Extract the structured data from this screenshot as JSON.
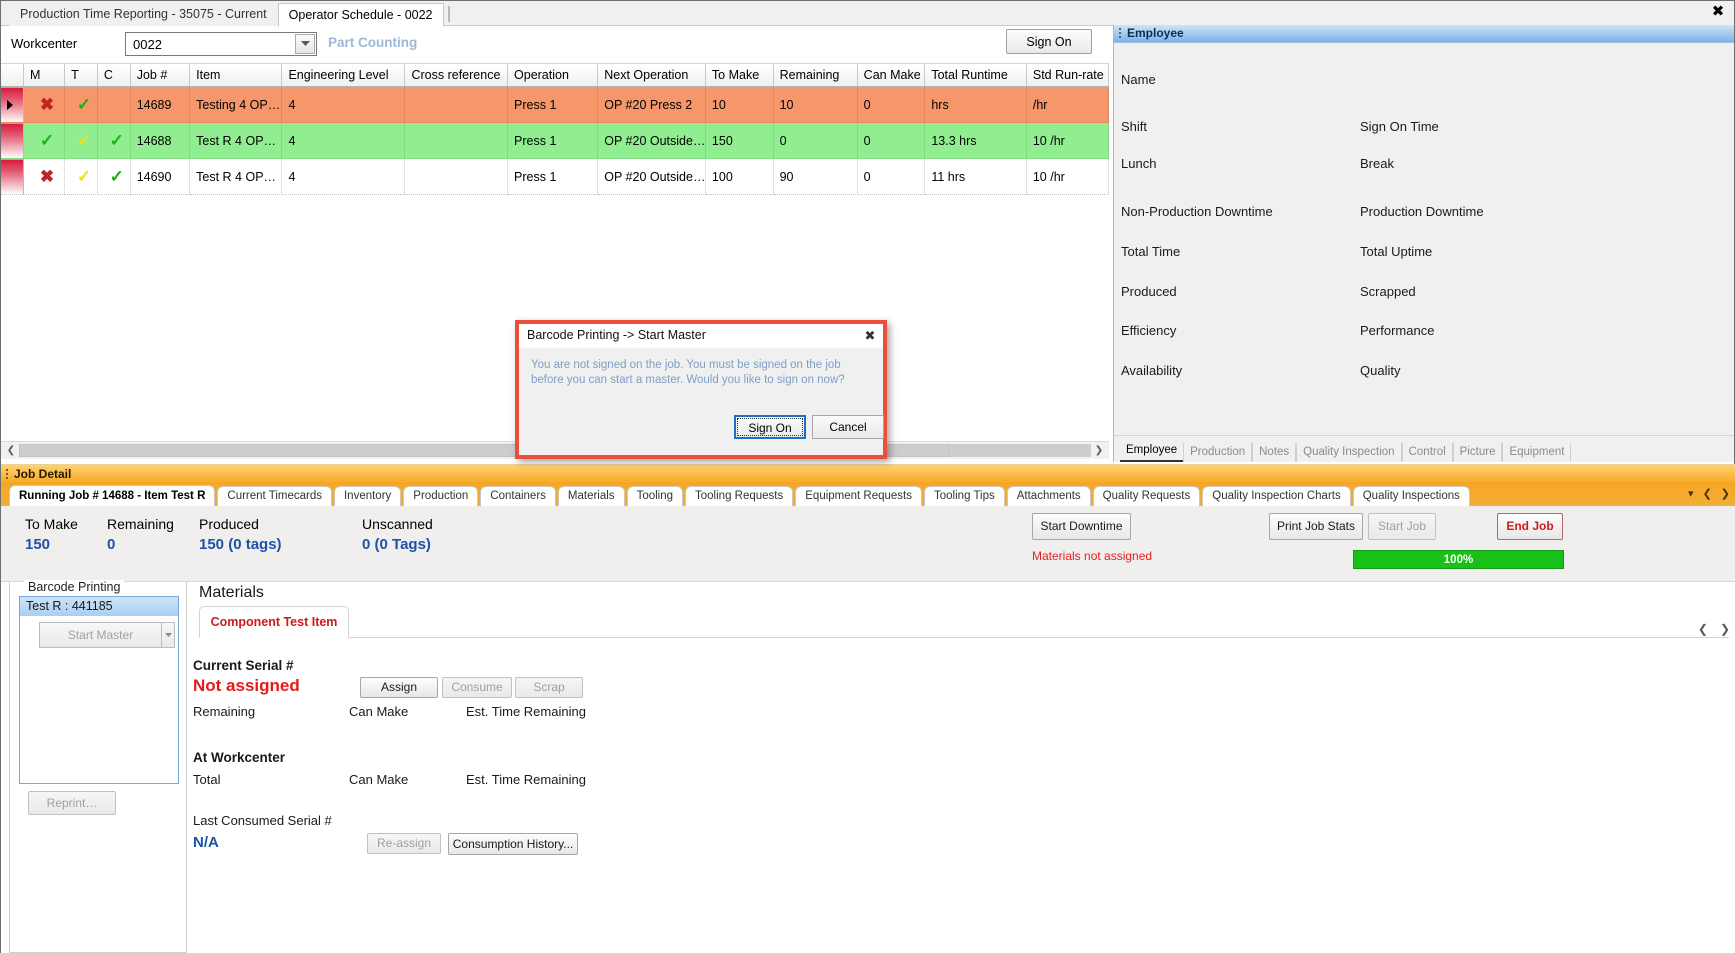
{
  "window": {
    "close_icon": "close-icon"
  },
  "top_tabs": [
    {
      "label": "Production Time Reporting - 35075 - Current",
      "selected": false
    },
    {
      "label": "Operator Schedule - 0022",
      "selected": true
    }
  ],
  "workcenter": {
    "label": "Workcenter",
    "value": "0022",
    "placeholder": "Workcenter",
    "status_text": "Part Counting",
    "sign_on_button": "Sign On"
  },
  "grid": {
    "columns": [
      "M",
      "T",
      "C",
      "Job #",
      "Item",
      "Engineering Level",
      "Cross reference",
      "Operation",
      "Next Operation",
      "To Make",
      "Remaining",
      "Can Make",
      "Total Runtime",
      "Std Run-rate"
    ],
    "rows": [
      {
        "selected": true,
        "row_color": "#f5976b",
        "m": "x",
        "t": "check-green",
        "c": "",
        "job": "14689",
        "item": "Testing  4  OP…",
        "eng_level": "4",
        "cross_ref": "",
        "operation": "Press 1",
        "next_operation": "OP #20 Press 2",
        "to_make": "10",
        "remaining": "10",
        "can_make": "0",
        "total_runtime": "hrs",
        "std_run_rate": "/hr"
      },
      {
        "selected": false,
        "row_color": "#90ee90",
        "m": "check-green",
        "t": "check-yellow",
        "c": "check-green",
        "job": "14688",
        "item": "Test R 4 OP…",
        "eng_level": "4",
        "cross_ref": "",
        "operation": "Press 1",
        "next_operation": "OP  #20  Outside…",
        "to_make": "150",
        "remaining": "0",
        "can_make": "0",
        "total_runtime": "13.3 hrs",
        "std_run_rate": "10 /hr"
      },
      {
        "selected": false,
        "row_color": "#ffffff",
        "m": "x",
        "t": "check-yellow",
        "c": "check-green",
        "job": "14690",
        "item": "Test R 4 OP…",
        "eng_level": "4",
        "cross_ref": "",
        "operation": "Press 1",
        "next_operation": "OP  #20  Outside…",
        "to_make": "100",
        "remaining": "90",
        "can_make": "0",
        "total_runtime": "11 hrs",
        "std_run_rate": "10 /hr"
      }
    ]
  },
  "employee_panel": {
    "title": "Employee",
    "labels_left": [
      "Name",
      "Shift",
      "Lunch",
      "Non-Production Downtime",
      "Total Time",
      "Produced",
      "Efficiency",
      "Availability"
    ],
    "labels_right": [
      "Sign On Time",
      "Break",
      "Production Downtime",
      "Total Uptime",
      "Scrapped",
      "Performance",
      "Quality"
    ],
    "tabs": [
      {
        "label": "Employee",
        "selected": true
      },
      {
        "label": "Production",
        "selected": false
      },
      {
        "label": "Notes",
        "selected": false
      },
      {
        "label": "Quality Inspection",
        "selected": false
      },
      {
        "label": "Control",
        "selected": false
      },
      {
        "label": "Picture",
        "selected": false
      },
      {
        "label": "Equipment",
        "selected": false
      }
    ]
  },
  "job_detail": {
    "bar_title": "Job Detail",
    "tabs": [
      {
        "label": "Running Job # 14688 - Item Test R",
        "selected": true
      },
      {
        "label": "Current Timecards",
        "selected": false
      },
      {
        "label": "Inventory",
        "selected": false
      },
      {
        "label": "Production",
        "selected": false
      },
      {
        "label": "Containers",
        "selected": false
      },
      {
        "label": "Materials",
        "selected": false
      },
      {
        "label": "Tooling",
        "selected": false
      },
      {
        "label": "Tooling Requests",
        "selected": false
      },
      {
        "label": "Equipment Requests",
        "selected": false
      },
      {
        "label": "Tooling Tips",
        "selected": false
      },
      {
        "label": "Attachments",
        "selected": false
      },
      {
        "label": "Quality Requests",
        "selected": false
      },
      {
        "label": "Quality Inspection Charts",
        "selected": false
      },
      {
        "label": "Quality Inspections",
        "selected": false
      }
    ]
  },
  "summary": {
    "blocks": [
      {
        "key": "To Make",
        "value": "150"
      },
      {
        "key": "Remaining",
        "value": "0"
      },
      {
        "key": "Produced",
        "value": "150 (0 tags)"
      },
      {
        "key": "Unscanned",
        "value": "0 (0 Tags)"
      }
    ],
    "start_downtime": "Start Downtime",
    "print_job_stats": "Print Job Stats",
    "start_job": "Start Job",
    "end_job": "End Job",
    "materials_warning": "Materials not assigned",
    "progress_label": "100%",
    "progress_color": "#18c018"
  },
  "barcode_printing": {
    "legend": "Barcode Printing",
    "list_items": [
      "Test R : 441185"
    ],
    "start_master": "Start Master",
    "reprint": "Reprint…"
  },
  "materials": {
    "title": "Materials",
    "tab": "Component Test Item",
    "current_serial_label": "Current Serial #",
    "current_serial_value": "Not assigned",
    "remaining_label": "Remaining",
    "can_make_label": "Can Make",
    "est_time_label": "Est. Time Remaining",
    "assign": "Assign",
    "consume": "Consume",
    "scrap": "Scrap",
    "at_workcenter_label": "At Workcenter",
    "total_label": "Total",
    "can_make_label2": "Can Make",
    "est_time_label2": "Est. Time Remaining",
    "last_consumed_label": "Last Consumed Serial #",
    "last_consumed_value": "N/A",
    "reassign": "Re-assign",
    "consumption_history": "Consumption History..."
  },
  "dialog": {
    "title": "Barcode Printing -> Start Master",
    "message": "You are not signed on the job. You must be signed on the job before you can start a master. Would you like to sign on now?",
    "primary_button": "Sign On",
    "secondary_button": "Cancel",
    "close_icon": "close-icon",
    "border_color": "#e8503a"
  }
}
